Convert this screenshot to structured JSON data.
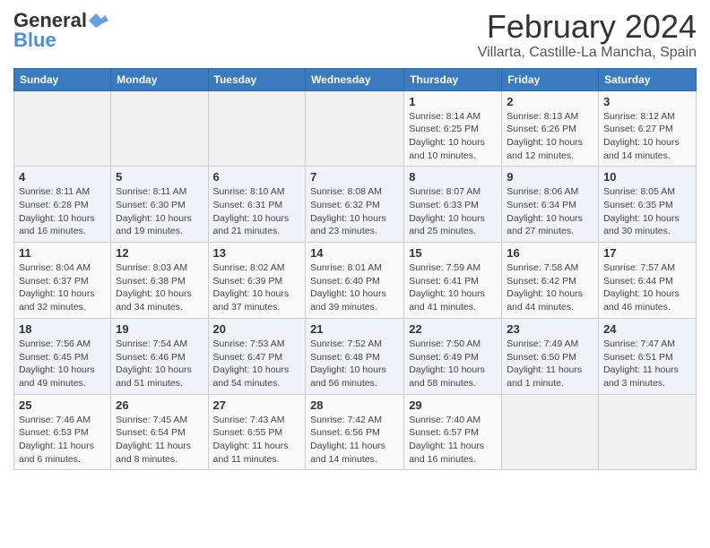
{
  "header": {
    "logo_general": "General",
    "logo_blue": "Blue",
    "main_title": "February 2024",
    "subtitle": "Villarta, Castille-La Mancha, Spain"
  },
  "calendar": {
    "weekdays": [
      "Sunday",
      "Monday",
      "Tuesday",
      "Wednesday",
      "Thursday",
      "Friday",
      "Saturday"
    ],
    "weeks": [
      [
        {
          "day": "",
          "info": ""
        },
        {
          "day": "",
          "info": ""
        },
        {
          "day": "",
          "info": ""
        },
        {
          "day": "",
          "info": ""
        },
        {
          "day": "1",
          "info": "Sunrise: 8:14 AM\nSunset: 6:25 PM\nDaylight: 10 hours\nand 10 minutes."
        },
        {
          "day": "2",
          "info": "Sunrise: 8:13 AM\nSunset: 6:26 PM\nDaylight: 10 hours\nand 12 minutes."
        },
        {
          "day": "3",
          "info": "Sunrise: 8:12 AM\nSunset: 6:27 PM\nDaylight: 10 hours\nand 14 minutes."
        }
      ],
      [
        {
          "day": "4",
          "info": "Sunrise: 8:11 AM\nSunset: 6:28 PM\nDaylight: 10 hours\nand 16 minutes."
        },
        {
          "day": "5",
          "info": "Sunrise: 8:11 AM\nSunset: 6:30 PM\nDaylight: 10 hours\nand 19 minutes."
        },
        {
          "day": "6",
          "info": "Sunrise: 8:10 AM\nSunset: 6:31 PM\nDaylight: 10 hours\nand 21 minutes."
        },
        {
          "day": "7",
          "info": "Sunrise: 8:08 AM\nSunset: 6:32 PM\nDaylight: 10 hours\nand 23 minutes."
        },
        {
          "day": "8",
          "info": "Sunrise: 8:07 AM\nSunset: 6:33 PM\nDaylight: 10 hours\nand 25 minutes."
        },
        {
          "day": "9",
          "info": "Sunrise: 8:06 AM\nSunset: 6:34 PM\nDaylight: 10 hours\nand 27 minutes."
        },
        {
          "day": "10",
          "info": "Sunrise: 8:05 AM\nSunset: 6:35 PM\nDaylight: 10 hours\nand 30 minutes."
        }
      ],
      [
        {
          "day": "11",
          "info": "Sunrise: 8:04 AM\nSunset: 6:37 PM\nDaylight: 10 hours\nand 32 minutes."
        },
        {
          "day": "12",
          "info": "Sunrise: 8:03 AM\nSunset: 6:38 PM\nDaylight: 10 hours\nand 34 minutes."
        },
        {
          "day": "13",
          "info": "Sunrise: 8:02 AM\nSunset: 6:39 PM\nDaylight: 10 hours\nand 37 minutes."
        },
        {
          "day": "14",
          "info": "Sunrise: 8:01 AM\nSunset: 6:40 PM\nDaylight: 10 hours\nand 39 minutes."
        },
        {
          "day": "15",
          "info": "Sunrise: 7:59 AM\nSunset: 6:41 PM\nDaylight: 10 hours\nand 41 minutes."
        },
        {
          "day": "16",
          "info": "Sunrise: 7:58 AM\nSunset: 6:42 PM\nDaylight: 10 hours\nand 44 minutes."
        },
        {
          "day": "17",
          "info": "Sunrise: 7:57 AM\nSunset: 6:44 PM\nDaylight: 10 hours\nand 46 minutes."
        }
      ],
      [
        {
          "day": "18",
          "info": "Sunrise: 7:56 AM\nSunset: 6:45 PM\nDaylight: 10 hours\nand 49 minutes."
        },
        {
          "day": "19",
          "info": "Sunrise: 7:54 AM\nSunset: 6:46 PM\nDaylight: 10 hours\nand 51 minutes."
        },
        {
          "day": "20",
          "info": "Sunrise: 7:53 AM\nSunset: 6:47 PM\nDaylight: 10 hours\nand 54 minutes."
        },
        {
          "day": "21",
          "info": "Sunrise: 7:52 AM\nSunset: 6:48 PM\nDaylight: 10 hours\nand 56 minutes."
        },
        {
          "day": "22",
          "info": "Sunrise: 7:50 AM\nSunset: 6:49 PM\nDaylight: 10 hours\nand 58 minutes."
        },
        {
          "day": "23",
          "info": "Sunrise: 7:49 AM\nSunset: 6:50 PM\nDaylight: 11 hours\nand 1 minute."
        },
        {
          "day": "24",
          "info": "Sunrise: 7:47 AM\nSunset: 6:51 PM\nDaylight: 11 hours\nand 3 minutes."
        }
      ],
      [
        {
          "day": "25",
          "info": "Sunrise: 7:46 AM\nSunset: 6:53 PM\nDaylight: 11 hours\nand 6 minutes."
        },
        {
          "day": "26",
          "info": "Sunrise: 7:45 AM\nSunset: 6:54 PM\nDaylight: 11 hours\nand 8 minutes."
        },
        {
          "day": "27",
          "info": "Sunrise: 7:43 AM\nSunset: 6:55 PM\nDaylight: 11 hours\nand 11 minutes."
        },
        {
          "day": "28",
          "info": "Sunrise: 7:42 AM\nSunset: 6:56 PM\nDaylight: 11 hours\nand 14 minutes."
        },
        {
          "day": "29",
          "info": "Sunrise: 7:40 AM\nSunset: 6:57 PM\nDaylight: 11 hours\nand 16 minutes."
        },
        {
          "day": "",
          "info": ""
        },
        {
          "day": "",
          "info": ""
        }
      ]
    ]
  }
}
